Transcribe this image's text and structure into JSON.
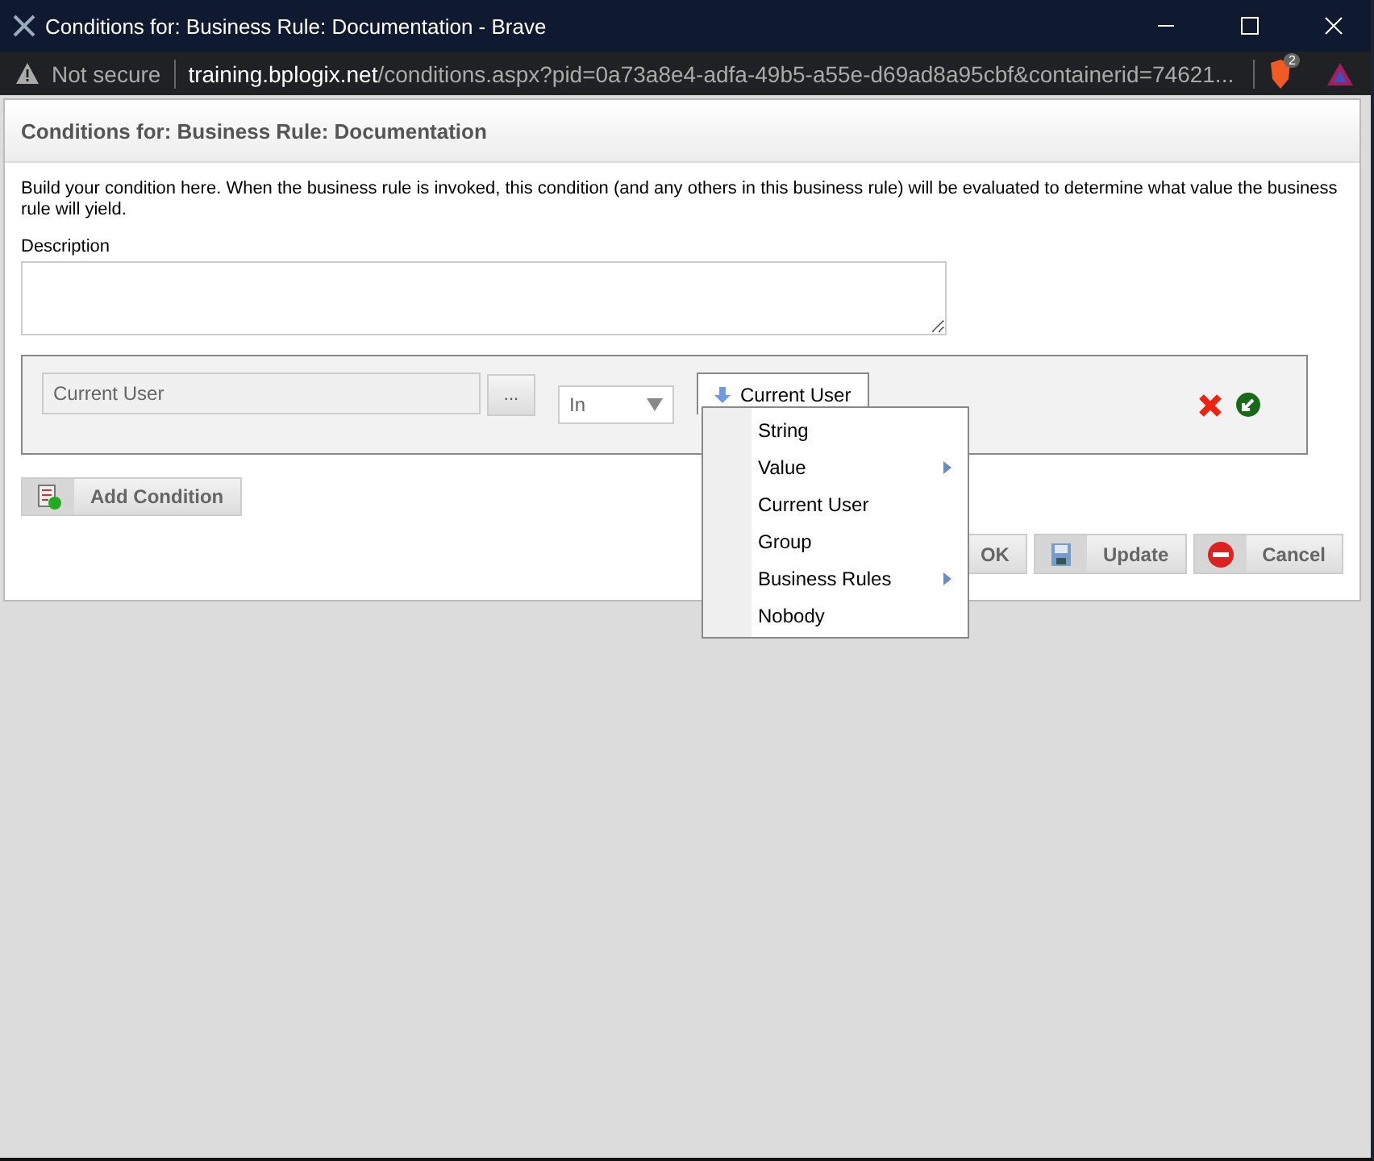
{
  "window": {
    "title": "Conditions for: Business Rule: Documentation - Brave"
  },
  "address_bar": {
    "security": "Not secure",
    "host": "training.bplogix.net",
    "path": "/conditions.aspx?pid=0a73a8e4-adfa-49b5-a55e-d69ad8a95cbf&containerid=74621...",
    "badge": "2"
  },
  "dialog": {
    "title": "Conditions for: Business Rule: Documentation",
    "intro": "Build your condition here. When the business rule is invoked, this condition (and any others in this business rule) will be evaluated to determine what value the business rule will yield.",
    "description_label": "Description"
  },
  "condition": {
    "left_value": "Current User",
    "browse": "...",
    "operator": "In",
    "right_button": "Current User"
  },
  "menu": [
    {
      "label": "String",
      "submenu": false
    },
    {
      "label": "Value",
      "submenu": true
    },
    {
      "label": "Current User",
      "submenu": false
    },
    {
      "label": "Group",
      "submenu": false
    },
    {
      "label": "Business Rules",
      "submenu": true
    },
    {
      "label": "Nobody",
      "submenu": false
    }
  ],
  "add_condition": "Add Condition",
  "buttons": [
    {
      "kind": "ok",
      "label": "OK"
    },
    {
      "kind": "update",
      "label": "Update"
    },
    {
      "kind": "cancel",
      "label": "Cancel"
    }
  ]
}
